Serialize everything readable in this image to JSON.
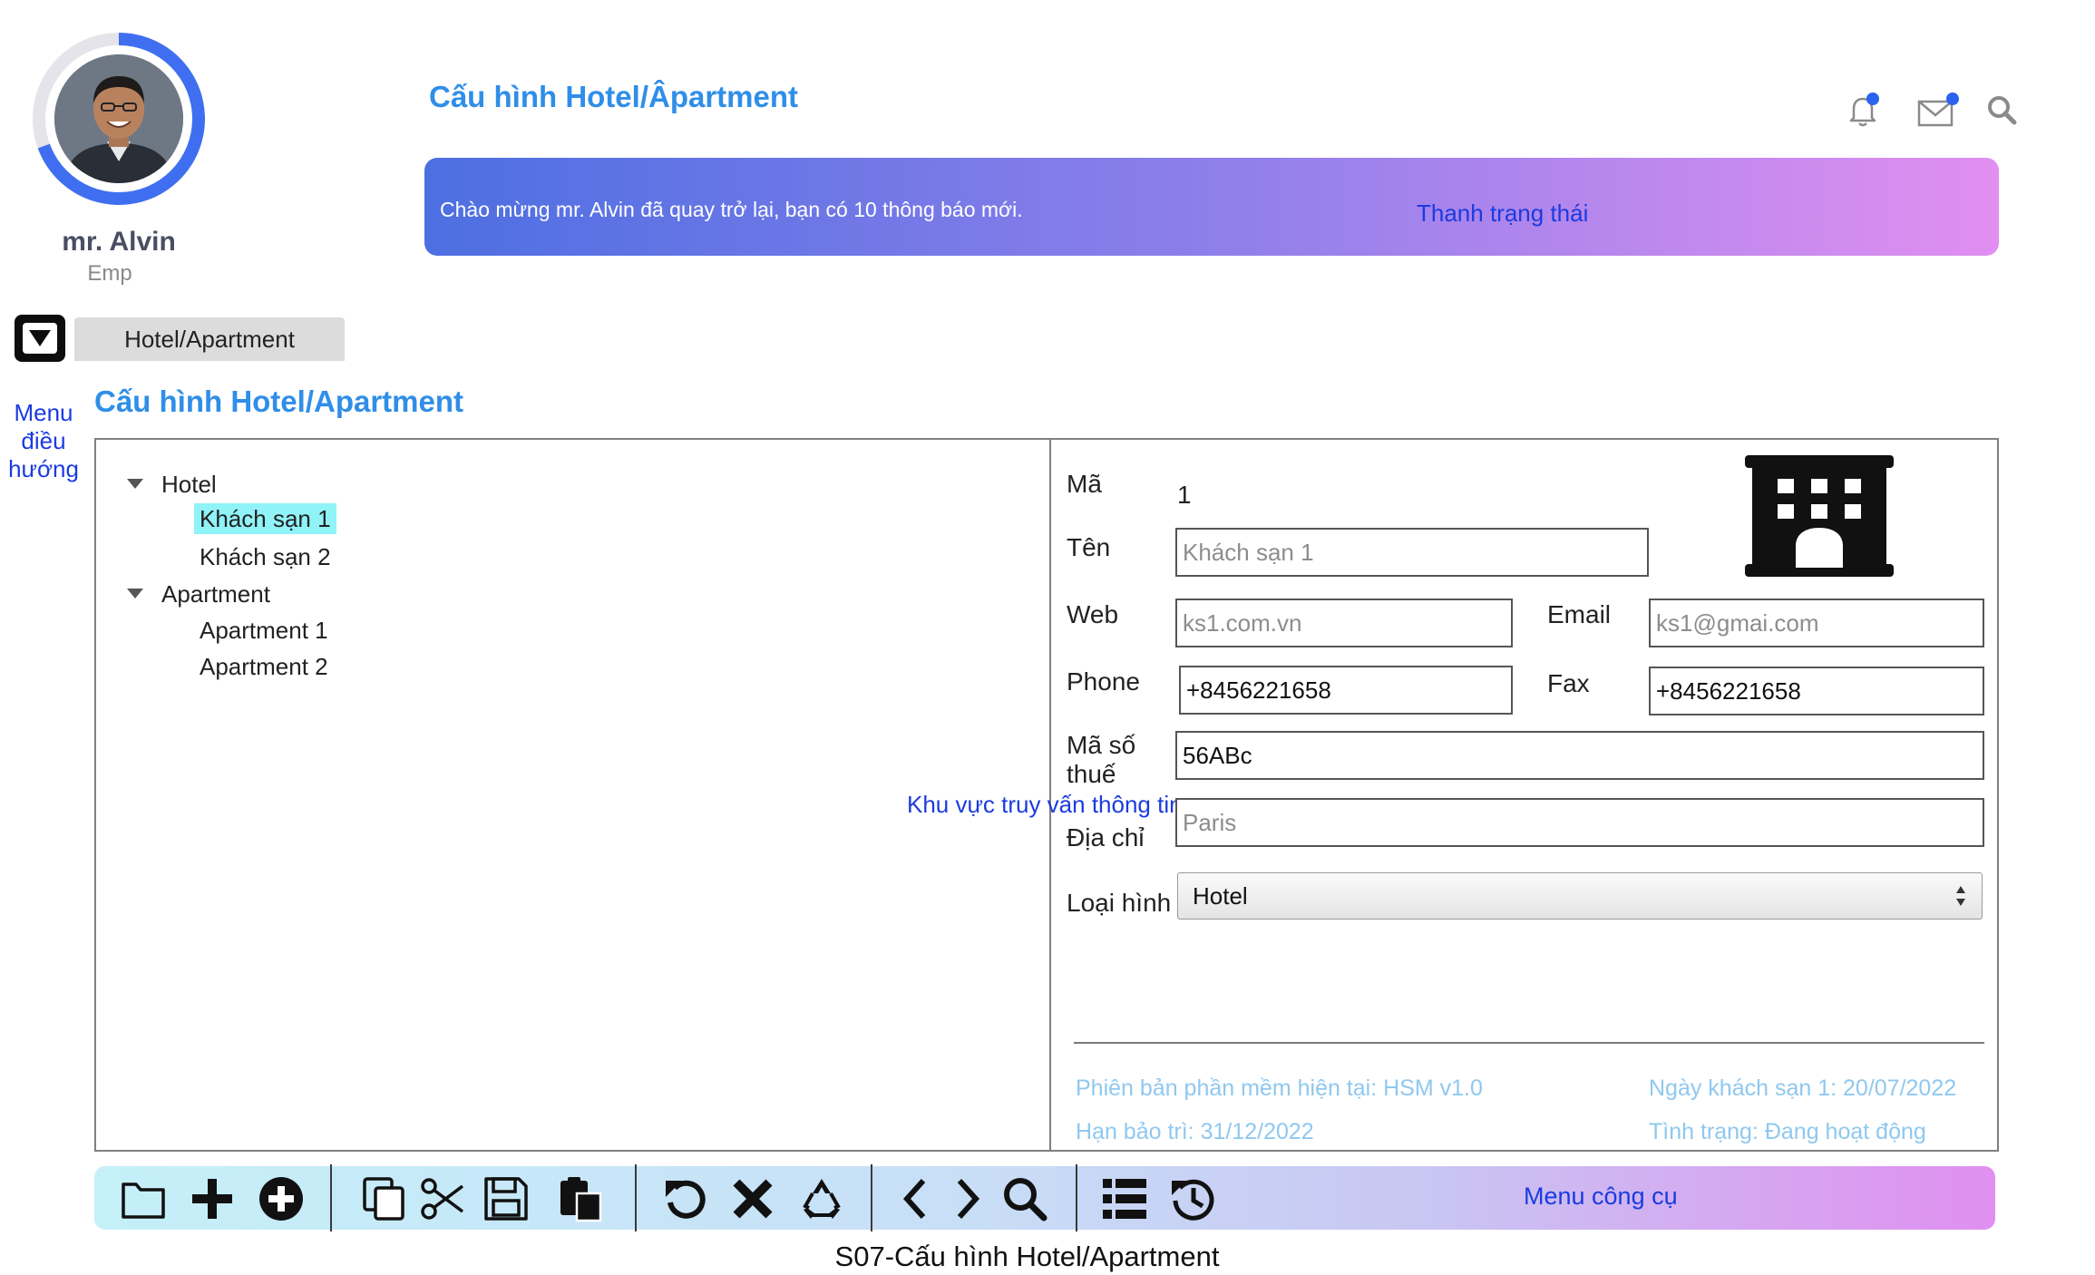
{
  "user": {
    "name": "mr. Alvin",
    "role": "Emp"
  },
  "header": {
    "title": "Cấu hình Hotel/Âpartment",
    "icons": [
      "bell-icon",
      "mail-icon",
      "search-icon"
    ]
  },
  "status_bar": {
    "message": "Chào mừng mr. Alvin đã quay trở lại, bạn có 10 thông báo mới.",
    "label": "Thanh trạng thái"
  },
  "breadcrumb": {
    "tab": "Hotel/Apartment"
  },
  "nav": {
    "label": "Menu điều hướng"
  },
  "section": {
    "title": "Cấu hình Hotel/Apartment"
  },
  "tree": [
    {
      "label": "Hotel",
      "expanded": true,
      "children": [
        {
          "label": "Khách sạn 1",
          "selected": true
        },
        {
          "label": "Khách sạn 2",
          "selected": false
        }
      ]
    },
    {
      "label": "Apartment",
      "expanded": true,
      "children": [
        {
          "label": "Apartment 1",
          "selected": false
        },
        {
          "label": "Apartment 2",
          "selected": false
        }
      ]
    }
  ],
  "query_area_label": "Khu vực truy vấn thông tin",
  "form": {
    "ma_label": "Mã",
    "ma_value": "1",
    "ten_label": "Tên",
    "ten_placeholder": "Khách sạn 1",
    "web_label": "Web",
    "web_placeholder": "ks1.com.vn",
    "email_label": "Email",
    "email_placeholder": "ks1@gmai.com",
    "phone_label": "Phone",
    "phone_value": "+8456221658",
    "fax_label": "Fax",
    "fax_value": "+8456221658",
    "tax_label_1": "Mã số",
    "tax_label_2": "thuế",
    "tax_value": "56ABc",
    "address_label": "Địa chỉ",
    "address_placeholder": "Paris",
    "type_label": "Loại hình",
    "type_selected": "Hotel",
    "image_icon": "building-icon"
  },
  "footer_info": {
    "version": "Phiên bản phần mềm hiện tại: HSM v1.0",
    "maintenance": "Hạn bảo trì: 31/12/2022",
    "date": "Ngày khách sạn 1: 20/07/2022",
    "status": "Tình trạng: Đang hoạt động"
  },
  "toolbar": {
    "label": "Menu công cụ",
    "icons": [
      "folder-icon",
      "plus-icon",
      "add-circle-icon",
      "copy-icon",
      "scissors-icon",
      "save-icon",
      "paste-icon",
      "undo-icon",
      "delete-icon",
      "recycle-icon",
      "chevron-left-icon",
      "chevron-right-icon",
      "search-icon",
      "list-icon",
      "history-icon"
    ]
  },
  "caption": "S07-Cấu hình Hotel/Apartment",
  "colors": {
    "accent_title": "#2f8ee8",
    "label_blue": "#1a3be0",
    "tree_highlight": "#8ff3f8",
    "footer_text": "#8fc8ef"
  }
}
